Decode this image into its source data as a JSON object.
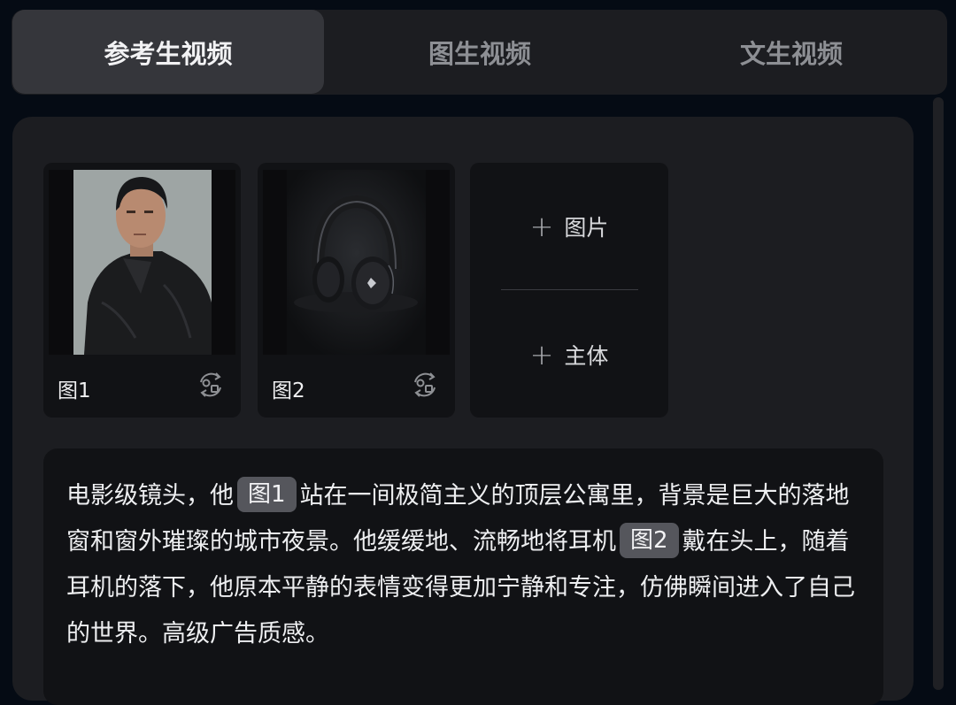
{
  "tabs": [
    {
      "label": "参考生视频",
      "active": true
    },
    {
      "label": "图生视频",
      "active": false
    },
    {
      "label": "文生视频",
      "active": false
    }
  ],
  "references": [
    {
      "label": "图1",
      "icon": "swap-icon",
      "thumbnail": "portrait-man-black-jacket"
    },
    {
      "label": "图2",
      "icon": "swap-icon",
      "thumbnail": "black-headphones"
    }
  ],
  "add_card": {
    "image_label": "图片",
    "subject_label": "主体",
    "plus_icon": "plus-icon"
  },
  "prompt": {
    "part1": "电影级镜头，他",
    "ref1": "图1",
    "part2": "站在一间极简主义的顶层公寓里，背景是巨大的落地窗和窗外璀璨的城市夜景。他缓缓地、流畅地将耳机",
    "ref2": "图2",
    "part3": "戴在头上，随着耳机的落下，他原本平静的表情变得更加宁静和专注，仿佛瞬间进入了自己的世界。高级广告质感。"
  },
  "colors": {
    "background": "#050b14",
    "panel": "#1c1d21",
    "card": "#111215",
    "active_tab": "#35363b",
    "chip": "#55565c"
  }
}
